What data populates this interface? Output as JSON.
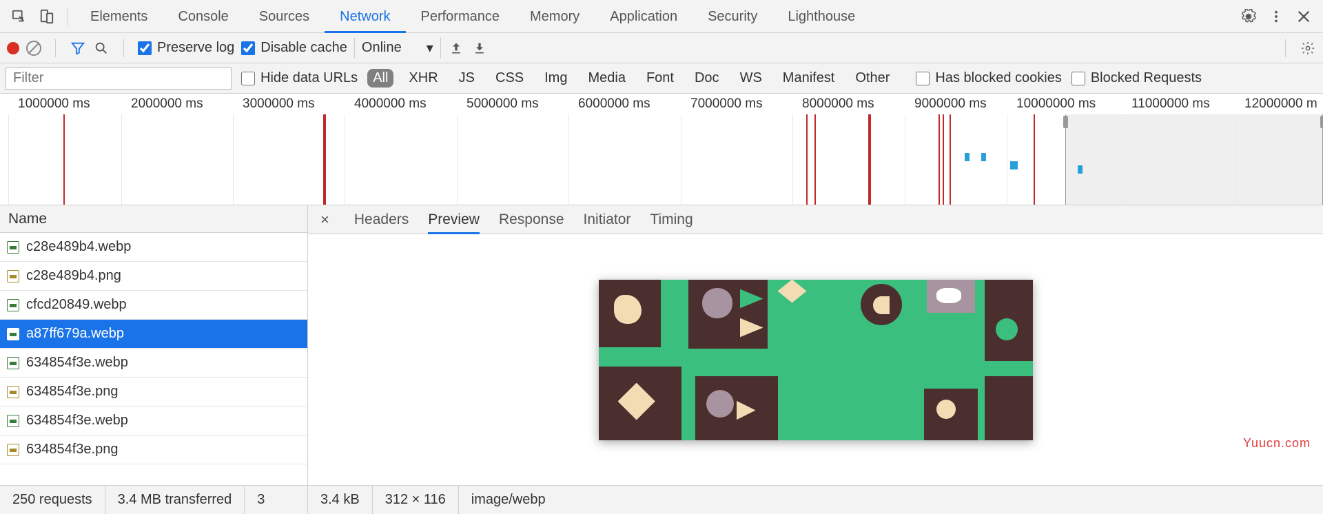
{
  "tabs": {
    "elements": "Elements",
    "console": "Console",
    "sources": "Sources",
    "network": "Network",
    "performance": "Performance",
    "memory": "Memory",
    "application": "Application",
    "security": "Security",
    "lighthouse": "Lighthouse"
  },
  "toolbar": {
    "preserve_log": "Preserve log",
    "disable_cache": "Disable cache",
    "throttle": "Online"
  },
  "filter": {
    "placeholder": "Filter",
    "hide_data_urls": "Hide data URLs",
    "types": {
      "all": "All",
      "xhr": "XHR",
      "js": "JS",
      "css": "CSS",
      "img": "Img",
      "media": "Media",
      "font": "Font",
      "doc": "Doc",
      "ws": "WS",
      "manifest": "Manifest",
      "other": "Other"
    },
    "has_blocked_cookies": "Has blocked cookies",
    "blocked_requests": "Blocked Requests"
  },
  "timeline": {
    "ticks": [
      "1000000 ms",
      "2000000 ms",
      "3000000 ms",
      "4000000 ms",
      "5000000 ms",
      "6000000 ms",
      "7000000 ms",
      "8000000 ms",
      "9000000 ms",
      "10000000 ms",
      "11000000 ms",
      "12000000 m"
    ]
  },
  "requests": {
    "header": "Name",
    "items": [
      {
        "name": "c28e489b4.webp",
        "type": "webp"
      },
      {
        "name": "c28e489b4.png",
        "type": "png"
      },
      {
        "name": "cfcd20849.webp",
        "type": "webp"
      },
      {
        "name": "a87ff679a.webp",
        "type": "webp",
        "selected": true
      },
      {
        "name": "634854f3e.webp",
        "type": "webp"
      },
      {
        "name": "634854f3e.png",
        "type": "png"
      },
      {
        "name": "634854f3e.webp",
        "type": "webp"
      },
      {
        "name": "634854f3e.png",
        "type": "png"
      }
    ]
  },
  "detail_tabs": {
    "headers": "Headers",
    "preview": "Preview",
    "response": "Response",
    "initiator": "Initiator",
    "timing": "Timing"
  },
  "status": {
    "requests": "250 requests",
    "transferred": "3.4 MB transferred",
    "three": "3",
    "size": "3.4 kB",
    "dims": "312 × 116",
    "mime": "image/webp"
  },
  "watermark": "Yuucn.com"
}
